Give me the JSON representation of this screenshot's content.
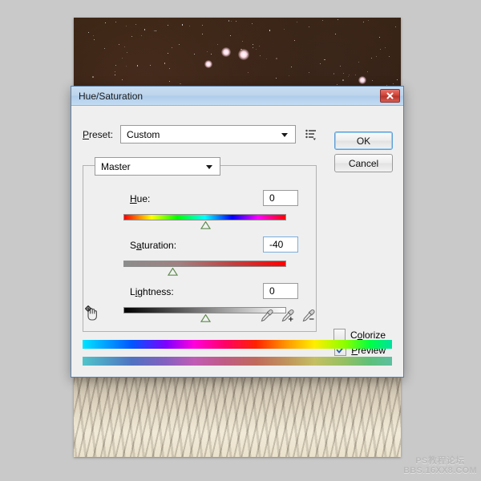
{
  "window": {
    "title": "Hue/Saturation",
    "close_icon": "close-x-icon"
  },
  "preset": {
    "label": "Preset:",
    "label_accel": "P",
    "value": "Custom",
    "caret_icon": "chevron-down-icon",
    "menu_icon": "preset-options-list-icon"
  },
  "buttons": {
    "ok": "OK",
    "cancel": "Cancel"
  },
  "channel": {
    "value": "Master",
    "caret_icon": "chevron-down-icon"
  },
  "sliders": [
    {
      "name": "hue",
      "label": "Hue:",
      "value": "0",
      "numeric_value": 0,
      "min": -180,
      "max": 180,
      "handle_percent": 50,
      "focused": false,
      "track_type": "hue-spectrum"
    },
    {
      "name": "saturation",
      "label": "Saturation:",
      "value": "-40",
      "numeric_value": -40,
      "min": -100,
      "max": 100,
      "handle_percent": 30,
      "focused": true,
      "track_type": "saturation-gray-to-red"
    },
    {
      "name": "lightness",
      "label": "Lightness:",
      "value": "0",
      "numeric_value": 0,
      "min": -100,
      "max": 100,
      "handle_percent": 50,
      "focused": false,
      "track_type": "black-to-white"
    }
  ],
  "tools": {
    "scrub_icon": "on-image-adjustment-hand-icon",
    "eyedropper_sample_icon": "eyedropper-icon",
    "eyedropper_add_icon": "eyedropper-plus-icon",
    "eyedropper_subtract_icon": "eyedropper-minus-icon"
  },
  "checkboxes": [
    {
      "name": "colorize",
      "label": "Colorize",
      "checked": false
    },
    {
      "name": "preview",
      "label": "Preview",
      "checked": true
    }
  ],
  "spectrum": {
    "top_bar_name": "original-hue-spectrum",
    "bottom_bar_name": "adjusted-hue-spectrum"
  },
  "watermark": {
    "line1": "PS教程论坛",
    "line2": "BBS.16XX8.COM"
  },
  "colors": {
    "app_background": "#c9c9c9",
    "dialog_background": "#efefef",
    "titlebar_blue": "#bcd4ec",
    "close_red": "#cf4338",
    "focus_blue": "#7aaede",
    "default_button_blue": "#5c9ed6",
    "handle_green": "#5f8a4e"
  },
  "image": {
    "description_top": "night-sky-stars-photo",
    "description_bottom": "badlands-canyon-landscape-photo"
  }
}
